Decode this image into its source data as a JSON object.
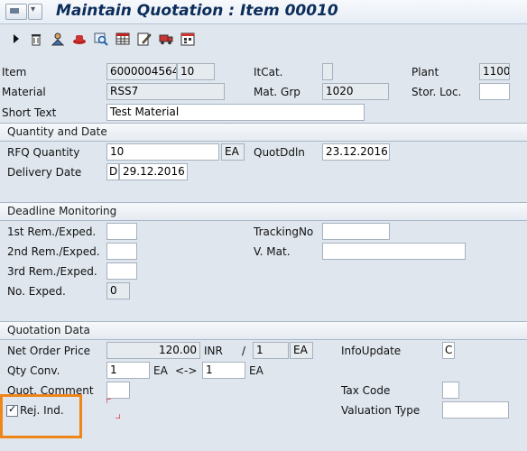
{
  "window": {
    "title": "Maintain Quotation : Item 00010"
  },
  "toolbar": {
    "icons": [
      "play-icon",
      "trash-icon",
      "person-icon",
      "hat-icon",
      "magnify-icon",
      "grid-icon",
      "edit-icon",
      "truck-icon",
      "calendar-icon"
    ]
  },
  "header": {
    "item_label": "Item",
    "item_value": "6000004564",
    "item_pos": "10",
    "itcat_label": "ItCat.",
    "itcat_value": "",
    "plant_label": "Plant",
    "plant_value": "1100",
    "material_label": "Material",
    "material_value": "RSS7",
    "matgrp_label": "Mat. Grp",
    "matgrp_value": "1020",
    "storloc_label": "Stor. Loc.",
    "storloc_value": "",
    "shorttext_label": "Short Text",
    "shorttext_value": "Test Material"
  },
  "qty_date": {
    "title": "Quantity and Date",
    "rfq_label": "RFQ Quantity",
    "rfq_value": "10",
    "rfq_unit": "EA",
    "quotddln_label": "QuotDdln",
    "quotddln_value": "23.12.2016",
    "delivery_label": "Delivery Date",
    "delivery_prefix": "D",
    "delivery_value": "29.12.2016"
  },
  "deadline": {
    "title": "Deadline Monitoring",
    "rem1_label": "1st Rem./Exped.",
    "rem1_value": "",
    "rem2_label": "2nd Rem./Exped.",
    "rem2_value": "",
    "rem3_label": "3rd Rem./Exped.",
    "rem3_value": "",
    "noexp_label": "No. Exped.",
    "noexp_value": "0",
    "tracking_label": "TrackingNo",
    "tracking_value": "",
    "vmat_label": "V. Mat.",
    "vmat_value": ""
  },
  "quotation": {
    "title": "Quotation Data",
    "netprice_label": "Net Order Price",
    "netprice_value": "120.00",
    "currency": "INR",
    "slash": "/",
    "per_value": "1",
    "per_unit": "EA",
    "infoupdate_label": "InfoUpdate",
    "infoupdate_value": "C",
    "qtyconv_label": "Qty Conv.",
    "qtyconv_from": "1",
    "qtyconv_from_unit": "EA",
    "arrow": "<->",
    "qtyconv_to": "1",
    "qtyconv_to_unit": "EA",
    "comment_label": "Quot. Comment",
    "comment_value": "",
    "taxcode_label": "Tax Code",
    "taxcode_value": "",
    "rejind_label": "Rej. Ind.",
    "rejind_checked": true,
    "valtype_label": "Valuation Type",
    "valtype_value": ""
  },
  "colors": {
    "highlight": "#f0851a",
    "title": "#0b2d5a"
  }
}
